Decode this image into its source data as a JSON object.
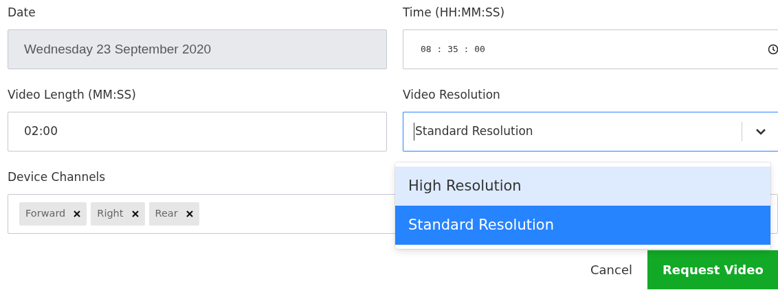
{
  "fields": [
    {
      "kind": "text",
      "label": "Date",
      "value": "Wednesday 23 September 2020",
      "disabled": true
    },
    {
      "kind": "time",
      "label": "Time (HH:MM:SS)",
      "value": "08 : 35 : 00",
      "disabled": false
    },
    {
      "kind": "text",
      "label": "Video Length (MM:SS)",
      "value": "02:00",
      "disabled": false
    },
    {
      "kind": "select",
      "label": "Video Resolution",
      "value": "Standard Resolution",
      "disabled": false,
      "expanded": true,
      "options": [
        {
          "label": "High Resolution",
          "selected": false,
          "highlighted": true
        },
        {
          "label": "Standard Resolution",
          "selected": true,
          "highlighted": false
        }
      ]
    },
    {
      "kind": "tags",
      "label": "Device Channels",
      "tags": [
        "Forward",
        "Right",
        "Rear"
      ]
    }
  ],
  "buttons": [
    {
      "kind": "link",
      "label": "Cancel"
    },
    {
      "kind": "primary",
      "label": "Request Video"
    }
  ]
}
